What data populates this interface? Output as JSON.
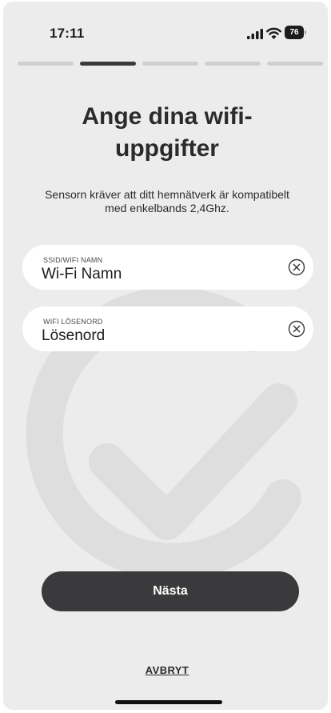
{
  "status_bar": {
    "time": "17:11",
    "battery": "76",
    "icons": [
      "signal-icon",
      "wifi-icon",
      "battery-icon"
    ]
  },
  "progress": {
    "total_steps": 5,
    "current_step": 2
  },
  "title": "Ange dina wifi-uppgifter",
  "subtitle": "Sensorn kräver att ditt hemnätverk är kompatibelt med enkelbands 2,4Ghz.",
  "form": {
    "ssid": {
      "label": "SSID/WIFI NAMN",
      "placeholder": "Wi-Fi Namn",
      "value": ""
    },
    "password": {
      "label": "WIFI LÖSENORD",
      "placeholder": "Lösenord",
      "value": ""
    }
  },
  "actions": {
    "next_label": "Nästa",
    "cancel_label": "AVBRYT"
  },
  "colors": {
    "background": "#ececec",
    "accent_dark": "#3a3a3c",
    "field_bg": "#ffffff",
    "progress_inactive": "#cfcfcf"
  }
}
